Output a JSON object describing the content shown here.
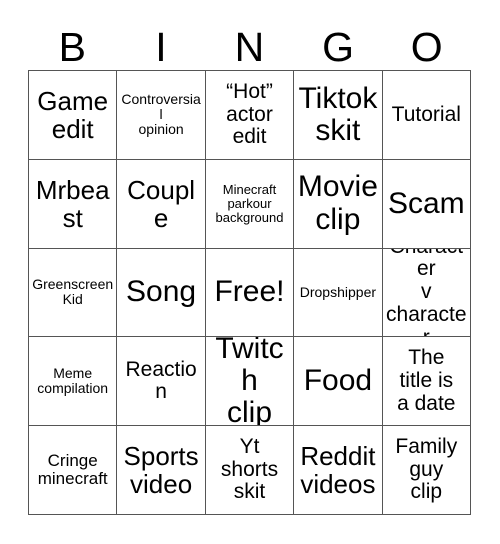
{
  "card": {
    "title_letters": [
      "B",
      "I",
      "N",
      "G",
      "O"
    ],
    "columns": 5,
    "rows": 5,
    "border_color": "#555555",
    "text_color": "#000000",
    "background_color": "#ffffff"
  },
  "rows": [
    {
      "cells": [
        {
          "text": "Game\nedit",
          "size": "fs-xl"
        },
        {
          "text": "Controversial\nopinion",
          "size": "fs-sm"
        },
        {
          "text": "“Hot”\nactor\nedit",
          "size": "fs-lg"
        },
        {
          "text": "Tiktok\nskit",
          "size": "fs-xxl"
        },
        {
          "text": "Tutorial",
          "size": "fs-lg"
        }
      ]
    },
    {
      "cells": [
        {
          "text": "Mrbeast",
          "size": "fs-xl"
        },
        {
          "text": "Couple",
          "size": "fs-xl"
        },
        {
          "text": "Minecraft\nparkour\nbackground",
          "size": "fs-xs"
        },
        {
          "text": "Movie\nclip",
          "size": "fs-xxl"
        },
        {
          "text": "Scam",
          "size": "fs-xxl"
        }
      ]
    },
    {
      "cells": [
        {
          "text": "Greenscreen\nKid",
          "size": "fs-sm"
        },
        {
          "text": "Song",
          "size": "fs-xxl"
        },
        {
          "text": "Free!",
          "size": "fs-xxl"
        },
        {
          "text": "Dropshipper",
          "size": "fs-sm"
        },
        {
          "text": "Character\nv\ncharacter",
          "size": "fs-lg"
        }
      ]
    },
    {
      "cells": [
        {
          "text": "Meme\ncompilation",
          "size": "fs-sm"
        },
        {
          "text": "Reaction",
          "size": "fs-lg"
        },
        {
          "text": "Twitch\nclip",
          "size": "fs-xxl"
        },
        {
          "text": "Food",
          "size": "fs-xxl"
        },
        {
          "text": "The\ntitle is\na date",
          "size": "fs-lg"
        }
      ]
    },
    {
      "cells": [
        {
          "text": "Cringe\nminecraft",
          "size": "fs-md"
        },
        {
          "text": "Sports\nvideo",
          "size": "fs-xl"
        },
        {
          "text": "Yt\nshorts\nskit",
          "size": "fs-lg"
        },
        {
          "text": "Reddit\nvideos",
          "size": "fs-xl"
        },
        {
          "text": "Family\nguy\nclip",
          "size": "fs-lg"
        }
      ]
    }
  ]
}
